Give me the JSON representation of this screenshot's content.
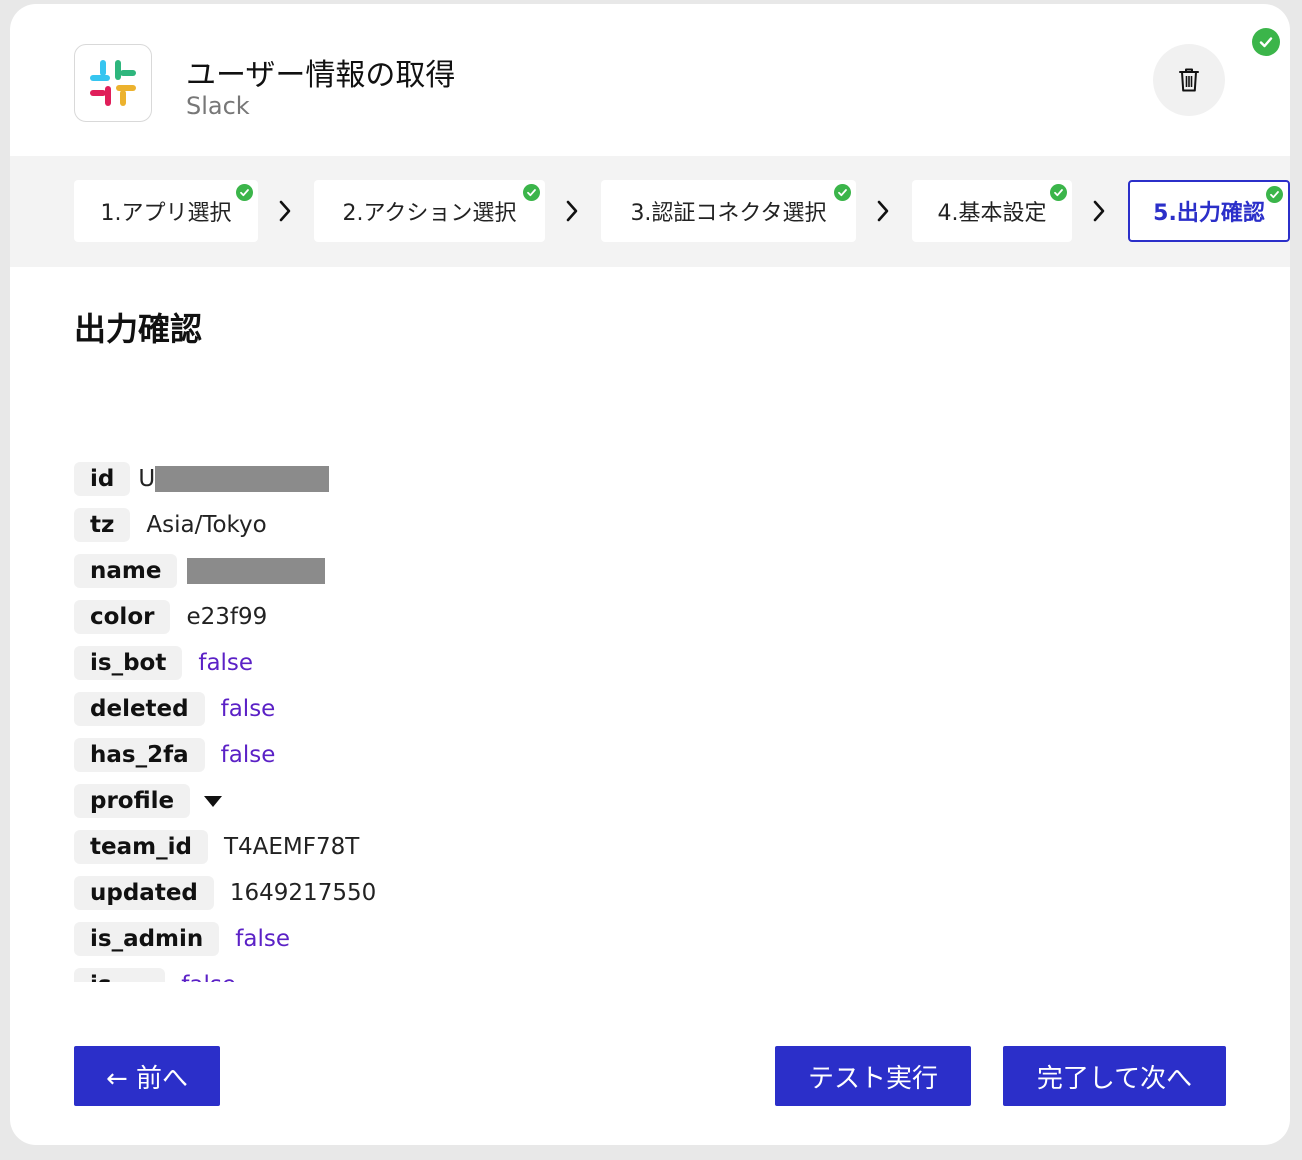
{
  "header": {
    "title": "ユーザー情報の取得",
    "subtitle": "Slack"
  },
  "steps": [
    {
      "label": "1.アプリ選択",
      "done": true
    },
    {
      "label": "2.アクション選択",
      "done": true
    },
    {
      "label": "3.認証コネクタ選択",
      "done": true
    },
    {
      "label": "4.基本設定",
      "done": true
    },
    {
      "label": "5.出力確認",
      "done": true,
      "active": true
    }
  ],
  "section_title": "出力確認",
  "output": [
    {
      "key": "id",
      "value": "U",
      "redacted": true
    },
    {
      "key": "tz",
      "value": "Asia/Tokyo"
    },
    {
      "key": "name",
      "value": "",
      "redacted": true
    },
    {
      "key": "color",
      "value": "e23f99"
    },
    {
      "key": "is_bot",
      "value": "false"
    },
    {
      "key": "deleted",
      "value": "false"
    },
    {
      "key": "has_2fa",
      "value": "false"
    },
    {
      "key": "profile",
      "expandable": true
    },
    {
      "key": "team_id",
      "value": "T4AEMF78T"
    },
    {
      "key": "updated",
      "value": "1649217550"
    },
    {
      "key": "is_admin",
      "value": "false"
    },
    {
      "key": "is_...",
      "value": "false",
      "partial": true
    }
  ],
  "buttons": {
    "back": "← 前へ",
    "test": "テスト実行",
    "next": "完了して次へ"
  },
  "colors": {
    "primary": "#2b2fc9",
    "success": "#3bb54a",
    "bool_value": "#5b21c6"
  }
}
